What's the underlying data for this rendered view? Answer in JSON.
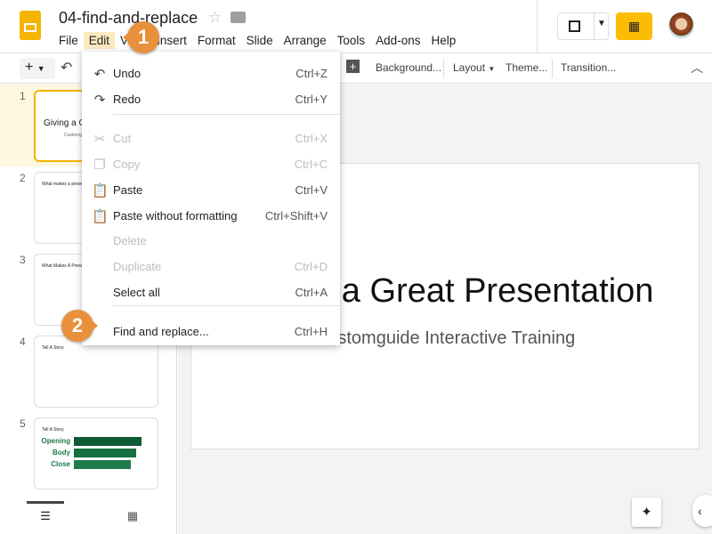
{
  "doc": {
    "title": "04-find-and-replace"
  },
  "menubar": [
    "File",
    "Edit",
    "View",
    "Insert",
    "Format",
    "Slide",
    "Arrange",
    "Tools",
    "Add-ons",
    "Help"
  ],
  "toolbar": {
    "background": "Background...",
    "layout": "Layout",
    "theme": "Theme...",
    "transition": "Transition..."
  },
  "edit_menu": [
    {
      "icon": "undo-icon",
      "glyph": "↶",
      "label": "Undo",
      "shortcut": "Ctrl+Z",
      "disabled": false
    },
    {
      "icon": "redo-icon",
      "glyph": "↷",
      "label": "Redo",
      "shortcut": "Ctrl+Y",
      "disabled": false
    },
    {
      "icon": "cut-icon",
      "glyph": "✂",
      "label": "Cut",
      "shortcut": "Ctrl+X",
      "disabled": true
    },
    {
      "icon": "copy-icon",
      "glyph": "❐",
      "label": "Copy",
      "shortcut": "Ctrl+C",
      "disabled": true
    },
    {
      "icon": "paste-icon",
      "glyph": "📋",
      "label": "Paste",
      "shortcut": "Ctrl+V",
      "disabled": false
    },
    {
      "icon": "paste-plain-icon",
      "glyph": "📋",
      "label": "Paste without formatting",
      "shortcut": "Ctrl+Shift+V",
      "disabled": false
    },
    {
      "icon": "",
      "glyph": "",
      "label": "Delete",
      "shortcut": "",
      "disabled": true
    },
    {
      "icon": "",
      "glyph": "",
      "label": "Duplicate",
      "shortcut": "Ctrl+D",
      "disabled": true
    },
    {
      "icon": "",
      "glyph": "",
      "label": "Select all",
      "shortcut": "Ctrl+A",
      "disabled": false
    },
    {
      "icon": "",
      "glyph": "",
      "label": "Find and replace...",
      "shortcut": "Ctrl+H",
      "disabled": false
    }
  ],
  "callouts": [
    "1",
    "2"
  ],
  "slides": [
    {
      "num": "1",
      "title": "Giving a Great Presentation",
      "sub": "Customguide Interactive Training"
    },
    {
      "num": "2",
      "title": "What makes a presentation great?"
    },
    {
      "num": "3",
      "title": "What Makes A Presentation"
    },
    {
      "num": "4",
      "title": "Tell A Story"
    },
    {
      "num": "5",
      "title": "Tell A Story",
      "rows": [
        "Opening",
        "Body",
        "Close"
      ]
    }
  ],
  "main_slide": {
    "title": "Giving a Great Presentation",
    "subtitle": "Customguide Interactive Training"
  },
  "colors": {
    "accent": "#e8903c",
    "slides_yellow": "#f4b400",
    "menu_active": "#fbe9c0",
    "green": "#1e7b4a"
  }
}
